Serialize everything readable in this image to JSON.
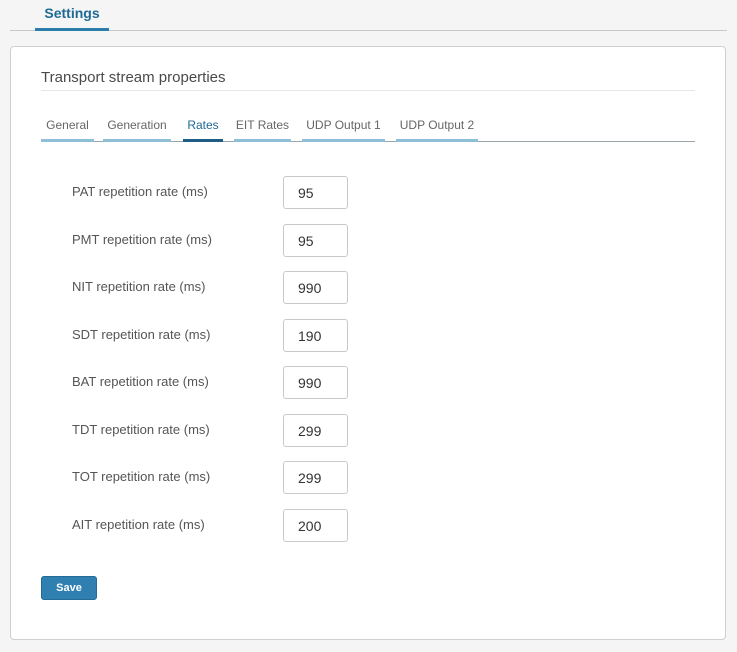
{
  "top_tabs": [
    {
      "label": "Settings"
    }
  ],
  "card": {
    "title": "Transport stream properties"
  },
  "subtabs": [
    {
      "label": "General"
    },
    {
      "label": "Generation"
    },
    {
      "label": "Rates"
    },
    {
      "label": "EIT Rates"
    },
    {
      "label": "UDP Output 1"
    },
    {
      "label": "UDP Output 2"
    }
  ],
  "active_subtab": "Rates",
  "fields": [
    {
      "label": "PAT repetition rate (ms)",
      "value": "95"
    },
    {
      "label": "PMT repetition rate (ms)",
      "value": "95"
    },
    {
      "label": "NIT repetition rate (ms)",
      "value": "990"
    },
    {
      "label": "SDT repetition rate (ms)",
      "value": "190"
    },
    {
      "label": "BAT repetition rate (ms)",
      "value": "990"
    },
    {
      "label": "TDT repetition rate (ms)",
      "value": "299"
    },
    {
      "label": "TOT repetition rate (ms)",
      "value": "299"
    },
    {
      "label": "AIT repetition rate (ms)",
      "value": "200"
    }
  ],
  "save_label": "Save",
  "colors": {
    "accent": "#2a7cab",
    "active_tab": "#1e5e84",
    "tab_underline": "#8fbfd6",
    "button": "#2f80b0"
  }
}
